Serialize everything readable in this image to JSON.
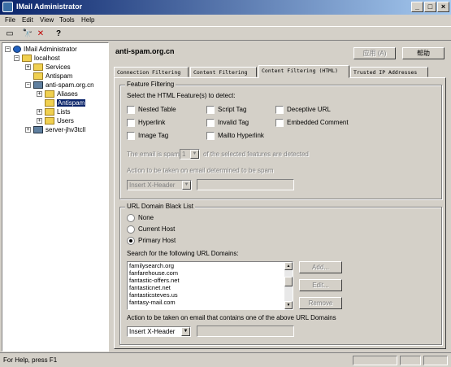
{
  "window": {
    "title": "IMail Administrator",
    "buttons": [
      "_",
      "□",
      "×"
    ]
  },
  "menu": [
    "File",
    "Edit",
    "View",
    "Tools",
    "Help"
  ],
  "toolbar": {
    "icons": [
      "open-folder-icon",
      "find-icon",
      "delete-icon",
      "help-icon"
    ],
    "glyphs": [
      "▭",
      "🔭",
      "✕",
      "?"
    ]
  },
  "tree": {
    "root": "IMail Administrator",
    "localhost": "localhost",
    "services": "Services",
    "antispam1": "Antispam",
    "domain": "anti-spam.org.cn",
    "aliases": "Aliases",
    "antispam2": "Antispam",
    "lists": "Lists",
    "users": "Users",
    "server": "server-jhv3tcll"
  },
  "panel": {
    "domain": "anti-spam.org.cn",
    "apply_label": "应用 (A)",
    "help_label": "帮助",
    "tabs": [
      "Connection Filtering",
      "Content Filtering",
      "Content Filtering (HTML)",
      "Trusted IP Addresses"
    ],
    "active_tab": 2
  },
  "feature": {
    "legend": "Feature Filtering",
    "prompt": "Select the HTML Feature(s) to detect:",
    "options": [
      "Nested Table",
      "Script Tag",
      "Deceptive URL",
      "Hyperlink",
      "Invalid Tag",
      "Embedded Comment",
      "Image Tag",
      "Mailto Hyperlink"
    ],
    "spam_if": "The email is spam if",
    "spam_count": "1",
    "spam_suffix": "of the selected features are detected",
    "action_label": "Action to be taken on email determined to be spam",
    "action_value": "Insert X-Header"
  },
  "url": {
    "legend": "URL Domain Black List",
    "radios": [
      "None",
      "Current Host",
      "Primary Host"
    ],
    "selected": 2,
    "search_label": "Search for the following URL Domains:",
    "domains": [
      "familysearch.org",
      "fanfarehouse.com",
      "fantastic-offers.net",
      "fantasticnet.net",
      "fantasticsteves.us",
      "fantasy-mail.com"
    ],
    "add_label": "Add...",
    "edit_label": "Edit...",
    "remove_label": "Remove",
    "action_label": "Action to be taken on email that contains one of the above URL Domains",
    "action_value": "Insert X-Header"
  },
  "status": {
    "text": "For Help, press F1"
  }
}
